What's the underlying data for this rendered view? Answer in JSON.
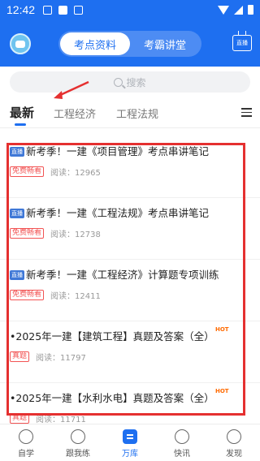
{
  "status_bar": {
    "time": "12:42"
  },
  "header": {
    "tabs": [
      {
        "label": "考点资料",
        "active": true
      },
      {
        "label": "考霸讲堂",
        "active": false
      }
    ],
    "live_label": "直播"
  },
  "search": {
    "placeholder": "搜索"
  },
  "category_tabs": [
    {
      "label": "最新",
      "active": true
    },
    {
      "label": "工程经济",
      "active": false
    },
    {
      "label": "工程法规",
      "active": false
    }
  ],
  "list": {
    "items": [
      {
        "live_tag": "直播",
        "title": "新考季！一建《项目管理》考点串讲笔记",
        "badge": "免费畅看",
        "reads": "阅读：12965"
      },
      {
        "live_tag": "直播",
        "title": "新考季！一建《工程法规》考点串讲笔记",
        "badge": "免费畅看",
        "reads": "阅读：12738"
      },
      {
        "live_tag": "直播",
        "title": "新考季！一建《工程经济》计算题专项训练",
        "badge": "免费畅看",
        "reads": "阅读：12411"
      },
      {
        "title": "•2025年一建【建筑工程】真题及答案（全）",
        "hot": "HOT",
        "badge": "真题",
        "reads": "阅读：11797"
      },
      {
        "title": "•2025年一建【水利水电】真题及答案（全）",
        "hot": "HOT",
        "badge": "真题",
        "reads": "阅读：11711"
      }
    ]
  },
  "bottom_nav": [
    {
      "label": "自学",
      "icon": "self-study-icon",
      "active": false
    },
    {
      "label": "跟我练",
      "icon": "practice-check-icon",
      "active": false
    },
    {
      "label": "万库",
      "icon": "library-icon",
      "active": true
    },
    {
      "label": "快讯",
      "icon": "lightning-icon",
      "active": false
    },
    {
      "label": "发现",
      "icon": "compass-icon",
      "active": false
    }
  ],
  "colors": {
    "brand_blue": "#1e6ff0",
    "annotation_red": "#e53030",
    "hot_orange": "#ff6a00"
  }
}
